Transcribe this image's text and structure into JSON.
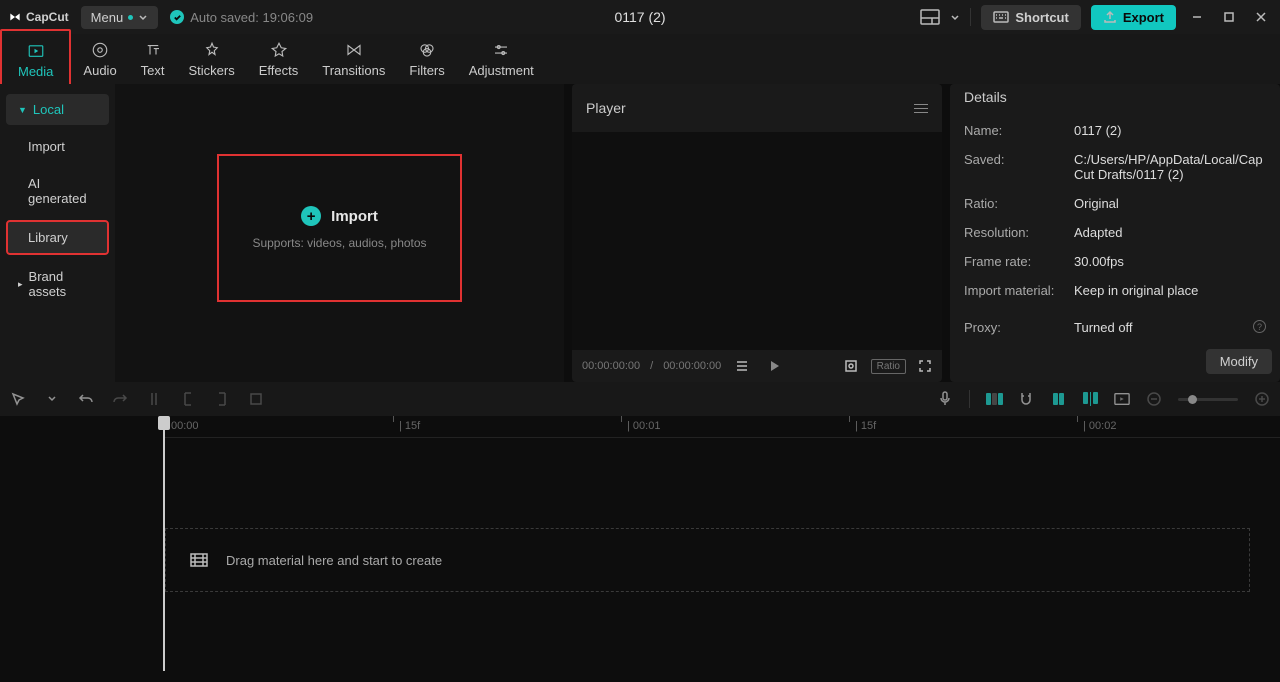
{
  "app_name": "CapCut",
  "menu_label": "Menu",
  "autosave_text": "Auto saved: 19:06:09",
  "project_title": "0117 (2)",
  "shortcut_label": "Shortcut",
  "export_label": "Export",
  "tabs": {
    "media": "Media",
    "audio": "Audio",
    "text": "Text",
    "stickers": "Stickers",
    "effects": "Effects",
    "transitions": "Transitions",
    "filters": "Filters",
    "adjustment": "Adjustment"
  },
  "sidebar": {
    "local": "Local",
    "import": "Import",
    "ai": "AI generated",
    "library": "Library",
    "brand": "Brand assets"
  },
  "import_box": {
    "label": "Import",
    "sub": "Supports: videos, audios, photos"
  },
  "player": {
    "title": "Player",
    "time_current": "00:00:00:00",
    "time_total": "00:00:00:00",
    "ratio": "Ratio"
  },
  "details": {
    "title": "Details",
    "rows": {
      "name": {
        "label": "Name:",
        "value": "0117 (2)"
      },
      "saved": {
        "label": "Saved:",
        "value": "C:/Users/HP/AppData/Local/CapCut Drafts/0117 (2)"
      },
      "ratio": {
        "label": "Ratio:",
        "value": "Original"
      },
      "resolution": {
        "label": "Resolution:",
        "value": "Adapted"
      },
      "framerate": {
        "label": "Frame rate:",
        "value": "30.00fps"
      },
      "import_mat": {
        "label": "Import material:",
        "value": "Keep in original place"
      },
      "proxy": {
        "label": "Proxy:",
        "value": "Turned off"
      }
    },
    "modify": "Modify"
  },
  "ruler": {
    "t0": "00:00",
    "t1": "15f",
    "t2": "00:01",
    "t3": "15f",
    "t4": "00:02"
  },
  "drop_text": "Drag material here and start to create"
}
